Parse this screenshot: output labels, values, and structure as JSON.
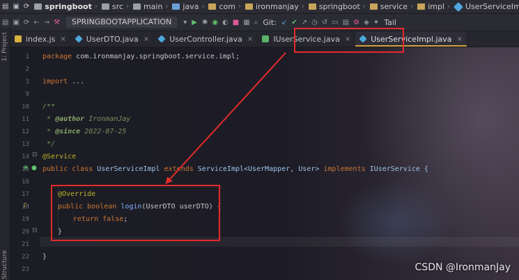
{
  "navbar": {
    "project": "springboot",
    "breadcrumbs": [
      "src",
      "main",
      "java",
      "com",
      "ironmanjay",
      "springboot",
      "service",
      "impl",
      "UserServiceImpl"
    ],
    "run_config": "SPRINGBOOTAPPLICATION",
    "git_label": "Git:",
    "tail_label": "Tail"
  },
  "left_strip": {
    "project_label": "1: Project",
    "structure_label": "Structure"
  },
  "tabs": [
    {
      "label": "index.js",
      "type": "js"
    },
    {
      "label": "UserDTO.java",
      "type": "class"
    },
    {
      "label": "UserController.java",
      "type": "class"
    },
    {
      "label": "IUserService.java",
      "type": "interface"
    },
    {
      "label": "UserServiceImpl.java",
      "type": "class",
      "active": true
    }
  ],
  "line_numbers": [
    "1",
    "2",
    "3",
    "9",
    "10",
    "11",
    "12",
    "13",
    "14",
    "15",
    "16",
    "17",
    "18",
    "19",
    "20",
    "21",
    "22",
    "23"
  ],
  "code": {
    "l1_kw": "package",
    "l1_rest": " com.ironmanjay.springboot.service.impl;",
    "l3_kw": "import",
    "l3_rest": " ...",
    "l10": "/**",
    "l11_star": " * ",
    "l11_tag": "@author",
    "l11_val": " IronmanJay",
    "l12_star": " * ",
    "l12_tag": "@since",
    "l12_val": " 2022-07-25",
    "l13": " */",
    "l14": "@Service",
    "l15_public": "public",
    "l15_class": " class",
    "l15_name": " UserServiceImpl ",
    "l15_extends": "extends",
    "l15_super": " ServiceImpl<UserMapper, User> ",
    "l15_impl": "implements",
    "l15_iface": " IUserService {",
    "l17": "@Override",
    "l18_public": "public",
    "l18_bool": " boolean ",
    "l18_fn": "login",
    "l18_rest": "(UserDTO userDTO) {",
    "l19_ret": "return",
    "l19_false": " false",
    "l19_semi": ";",
    "l20": "}",
    "l22": "}"
  },
  "watermark": "CSDN @IronmanJay",
  "colors": {
    "annotation_red": "#e52b2b",
    "active_tab_underline": "#d0a13c"
  }
}
